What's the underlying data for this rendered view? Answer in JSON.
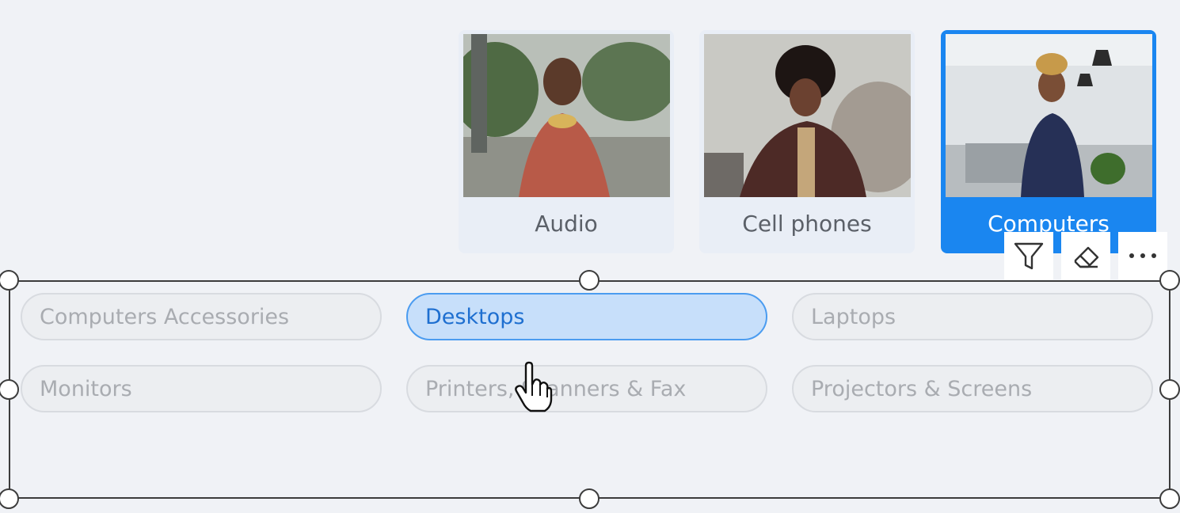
{
  "tiles": [
    {
      "label": "Audio",
      "selected": false
    },
    {
      "label": "Cell phones",
      "selected": false
    },
    {
      "label": "Computers",
      "selected": true
    }
  ],
  "toolbar": {
    "filter_icon": "filter-icon",
    "clear_icon": "eraser-icon",
    "more_label": "···"
  },
  "slicer": {
    "items": [
      {
        "label": "Computers Accessories",
        "selected": false
      },
      {
        "label": "Desktops",
        "selected": true
      },
      {
        "label": "Laptops",
        "selected": false
      },
      {
        "label": "Monitors",
        "selected": false
      },
      {
        "label": "Printers, Scanners & Fax",
        "selected": false
      },
      {
        "label": "Projectors & Screens",
        "selected": false
      }
    ]
  },
  "colors": {
    "accent": "#1a86f0",
    "selected_pill_bg": "#c7dffa",
    "selected_pill_text": "#1e6fd0",
    "background": "#f0f2f6"
  },
  "cursor": "hand-pointer-icon"
}
